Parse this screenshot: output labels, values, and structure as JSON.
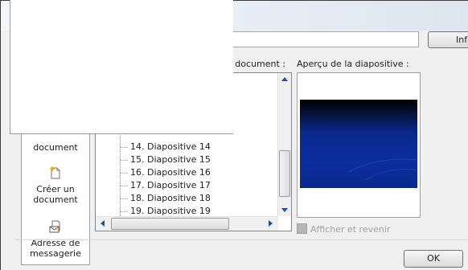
{
  "buttons": {
    "info_label": "Info",
    "ok_label": "OK"
  },
  "labels": {
    "document_places": "ce document :",
    "preview": "Aperçu de la diapositive :"
  },
  "nav": {
    "place_in_document": "document",
    "create_document_line1": "Créer un",
    "create_document_line2": "document",
    "email_line1": "Adresse de",
    "email_line2": "messagerie"
  },
  "tree": {
    "items": [
      "14. Diapositive 14",
      "15. Diapositive 15",
      "16. Diapositive 16",
      "17. Diapositive 17",
      "18. Diapositive 18",
      "19. Diapositive 19"
    ]
  },
  "checkbox": {
    "label": "Afficher et revenir",
    "checked": false,
    "enabled": false
  },
  "icons": {
    "create_document": "new-document-icon",
    "email": "email-address-icon"
  },
  "colors": {
    "slide_dark": "#000000",
    "slide_blue": "#0b2d9e"
  }
}
